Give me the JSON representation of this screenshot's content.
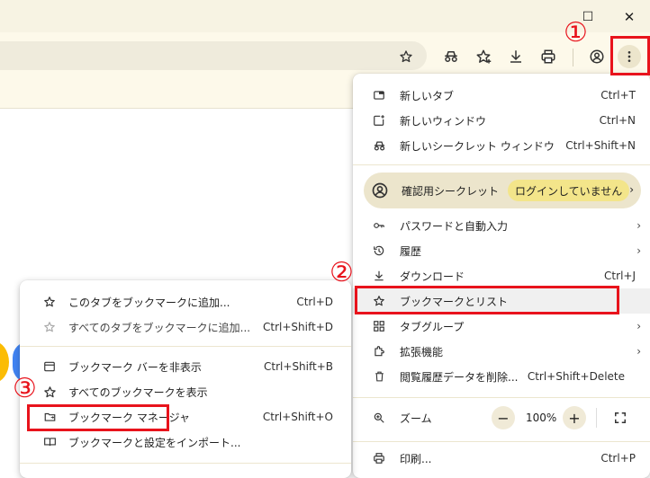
{
  "window": {
    "restore_glyph": "☐",
    "close_glyph": "✕"
  },
  "toolbar_icons": [
    "star-icon",
    "incognito-icon",
    "bookmarks-star-icon",
    "download-icon",
    "print-icon",
    "profile-icon",
    "more-menu-icon"
  ],
  "main_menu": {
    "items": [
      {
        "label": "新しいタブ",
        "shortcut": "Ctrl+T"
      },
      {
        "label": "新しいウィンドウ",
        "shortcut": "Ctrl+N"
      },
      {
        "label": "新しいシークレット ウィンドウ",
        "shortcut": "Ctrl+Shift+N"
      }
    ],
    "profile": {
      "label": "確認用シークレット",
      "badge": "ログインしていません"
    },
    "items2": [
      {
        "label": "パスワードと自動入力"
      },
      {
        "label": "履歴"
      },
      {
        "label": "ダウンロード",
        "shortcut": "Ctrl+J"
      },
      {
        "label": "ブックマークとリスト"
      },
      {
        "label": "タブグループ"
      },
      {
        "label": "拡張機能"
      },
      {
        "label": "閲覧履歴データを削除...",
        "shortcut": "Ctrl+Shift+Delete"
      }
    ],
    "zoom": {
      "label": "ズーム",
      "minus": "−",
      "value": "100%",
      "plus": "+"
    },
    "print": {
      "label": "印刷...",
      "shortcut": "Ctrl+P"
    }
  },
  "bookmark_submenu": {
    "items": [
      {
        "label": "このタブをブックマークに追加...",
        "shortcut": "Ctrl+D"
      },
      {
        "label": "すべてのタブをブックマークに追加...",
        "shortcut": "Ctrl+Shift+D"
      }
    ],
    "items2": [
      {
        "label": "ブックマーク バーを非表示",
        "shortcut": "Ctrl+Shift+B"
      },
      {
        "label": "すべてのブックマークを表示"
      },
      {
        "label": "ブックマーク マネージャ",
        "shortcut": "Ctrl+Shift+O"
      },
      {
        "label": "ブックマークと設定をインポート..."
      }
    ]
  },
  "annotations": {
    "one": "①",
    "two": "②",
    "three": "③"
  },
  "colors": {
    "accent_red": "#e8131c",
    "badge_yellow": "#f3e58a"
  }
}
